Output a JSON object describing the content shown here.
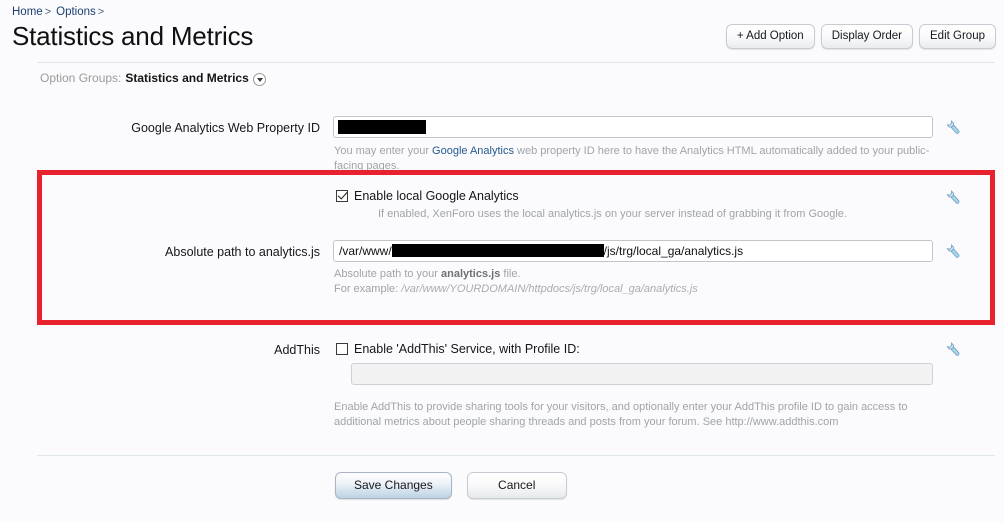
{
  "breadcrumb": {
    "items": [
      {
        "label": "Home",
        "separator": ">"
      },
      {
        "label": "Options",
        "separator": ">"
      }
    ]
  },
  "page_title": "Statistics and Metrics",
  "toolbar": {
    "add_option_label": "+ Add Option",
    "display_order_label": "Display Order",
    "edit_group_label": "Edit Group"
  },
  "option_groups": {
    "label": "Option Groups:",
    "value": "Statistics and Metrics",
    "dropdown_icon": "chevron-down-icon"
  },
  "fields": {
    "ga_web_property": {
      "label": "Google Analytics Web Property ID",
      "value": "",
      "redacted": true,
      "hint_before": "You may enter your ",
      "hint_link": "Google Analytics",
      "hint_after": " web property ID here to have the Analytics HTML automatically added to your public-facing pages."
    },
    "enable_local_ga": {
      "checkbox_label": "Enable local Google Analytics",
      "checked": true,
      "hint": "If enabled, XenForo uses the local analytics.js on your server instead of grabbing it from Google."
    },
    "analytics_path": {
      "label": "Absolute path to analytics.js",
      "value_prefix": "/var/www/",
      "value_suffix": "/js/trg/local_ga/analytics.js",
      "redacted": true,
      "hint_line1_before": "Absolute path to your ",
      "hint_line1_bold": "analytics.js",
      "hint_line1_after": " file.",
      "hint_line2_prefix": "For example: ",
      "hint_line2_example": "/var/www/YOURDOMAIN/httpdocs/js/trg/local_ga/analytics.js"
    },
    "addthis": {
      "label": "AddThis",
      "checkbox_label": "Enable 'AddThis' Service, with Profile ID:",
      "checked": false,
      "profile_id_value": "",
      "hint": "Enable AddThis to provide sharing tools for your visitors, and optionally enter your AddThis profile ID to gain access to additional metrics about people sharing threads and posts from your forum. See http://www.addthis.com"
    }
  },
  "icons": {
    "wrench": "wrench-icon"
  },
  "footer": {
    "save_label": "Save Changes",
    "cancel_label": "Cancel"
  },
  "annotation": {
    "highlight_color": "#e8212e"
  }
}
